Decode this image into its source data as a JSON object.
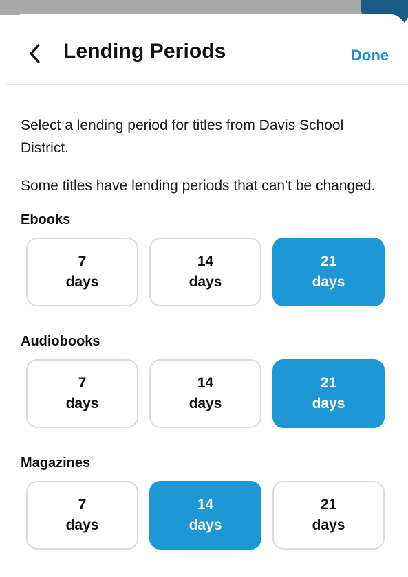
{
  "header": {
    "title": "Lending Periods",
    "done_label": "Done"
  },
  "body": {
    "intro": "Select a lending period for titles from Davis School District.",
    "note": "Some titles have lending periods that can't be changed."
  },
  "sections": [
    {
      "label": "Ebooks",
      "options": [
        {
          "num": "7",
          "unit": "days",
          "selected": false
        },
        {
          "num": "14",
          "unit": "days",
          "selected": false
        },
        {
          "num": "21",
          "unit": "days",
          "selected": true
        }
      ]
    },
    {
      "label": "Audiobooks",
      "options": [
        {
          "num": "7",
          "unit": "days",
          "selected": false
        },
        {
          "num": "14",
          "unit": "days",
          "selected": false
        },
        {
          "num": "21",
          "unit": "days",
          "selected": true
        }
      ]
    },
    {
      "label": "Magazines",
      "options": [
        {
          "num": "7",
          "unit": "days",
          "selected": false
        },
        {
          "num": "14",
          "unit": "days",
          "selected": true
        },
        {
          "num": "21",
          "unit": "days",
          "selected": false
        }
      ]
    }
  ],
  "colors": {
    "accent": "#1e98d4",
    "done": "#1e8fd0",
    "border": "#dcdcdc"
  },
  "icons": {
    "back": "chevron-left-icon"
  }
}
